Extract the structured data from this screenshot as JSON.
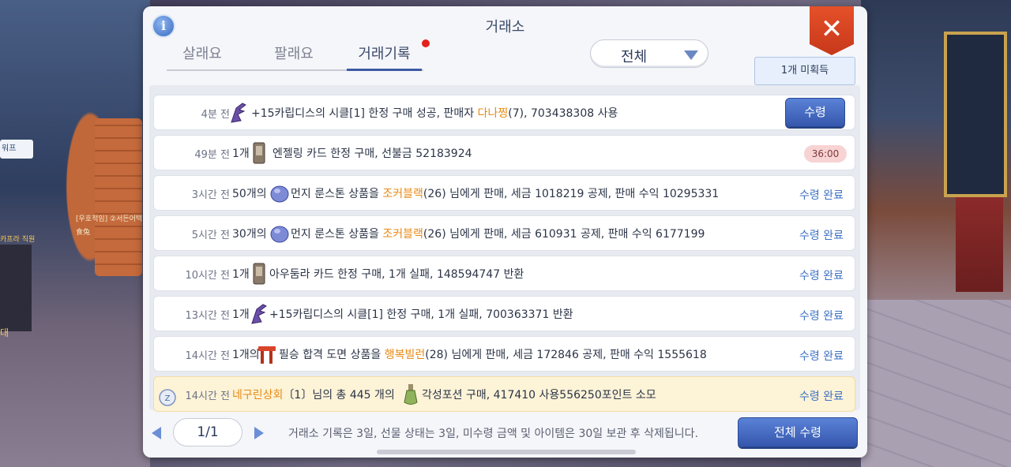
{
  "panel": {
    "title": "거래소",
    "unclaimed_label": "1개 미획득",
    "filter_value": "전체"
  },
  "tabs": [
    {
      "label": "살래요",
      "active": false
    },
    {
      "label": "팔래요",
      "active": false
    },
    {
      "label": "거래기록",
      "active": true
    }
  ],
  "background": {
    "tag": "워프",
    "text1": "[우호적임] ②서든어택",
    "text2": "食兔",
    "text3": "카프라 직원",
    "text4": "대"
  },
  "rows": [
    {
      "time": "4분 전",
      "qty": "",
      "icon": "whip-weapon-icon",
      "desc_pre": "+15카립디스의 시클[1] 한정 구매 성공, 판매자 ",
      "desc_hl": "다나찡",
      "desc_post": "(7), 703438308 사용",
      "status": "",
      "button": "수령",
      "timer": ""
    },
    {
      "time": "49분 전",
      "qty": "1개",
      "icon": "card-icon",
      "desc_pre": "엔젤링 카드 한정 구매, 선불금 52183924",
      "desc_hl": "",
      "desc_post": "",
      "status": "",
      "button": "",
      "timer": "36:00"
    },
    {
      "time": "3시간 전",
      "qty": "50개의",
      "icon": "runestone-icon",
      "desc_pre": "먼지 룬스톤 상품을 ",
      "desc_hl": "조커블랙",
      "desc_post": "(26) 님에게 판매, 세금 1018219 공제, 판매 수익 10295331",
      "status": "수령 완료",
      "button": "",
      "timer": ""
    },
    {
      "time": "5시간 전",
      "qty": "30개의",
      "icon": "runestone-icon",
      "desc_pre": "먼지 룬스톤 상품을 ",
      "desc_hl": "조커블랙",
      "desc_post": "(26) 님에게 판매, 세금 610931 공제, 판매 수익 6177199",
      "status": "수령 완료",
      "button": "",
      "timer": ""
    },
    {
      "time": "10시간 전",
      "qty": "1개",
      "icon": "card-icon",
      "desc_pre": "아우둠라 카드 한정 구매, 1개 실패, 148594747 반환",
      "desc_hl": "",
      "desc_post": "",
      "status": "수령 완료",
      "button": "",
      "timer": ""
    },
    {
      "time": "13시간 전",
      "qty": "1개",
      "icon": "whip-weapon-icon",
      "desc_pre": "+15카립디스의 시클[1] 한정 구매, 1개 실패, 700363371 반환",
      "desc_hl": "",
      "desc_post": "",
      "status": "수령 완료",
      "button": "",
      "timer": ""
    },
    {
      "time": "14시간 전",
      "qty": "1개의",
      "icon": "blueprint-icon",
      "desc_pre": "필승 합격 도면 상품을 ",
      "desc_hl": "행복빌런",
      "desc_post": "(28) 님에게 판매, 세금 172846 공제, 판매 수익 1555618",
      "status": "수령 완료",
      "button": "",
      "timer": ""
    },
    {
      "time": "14시간 전",
      "qty": "",
      "icon": "potion-icon",
      "desc_pre": "",
      "desc_hl": "네구린상회",
      "desc_post": "〔1〕님의 총 445 개의",
      "desc_post2": "각성포션 구매, 417410 사용556250포인트 소모",
      "status": "수령 완료",
      "button": "",
      "timer": ""
    }
  ],
  "footer": {
    "page": "1/1",
    "notice": "거래소 기록은 3일, 선물 상태는 3일, 미수령 금액 및 아이템은 30일 보관 후 삭제됩니다.",
    "claim_all": "전체 수령"
  }
}
